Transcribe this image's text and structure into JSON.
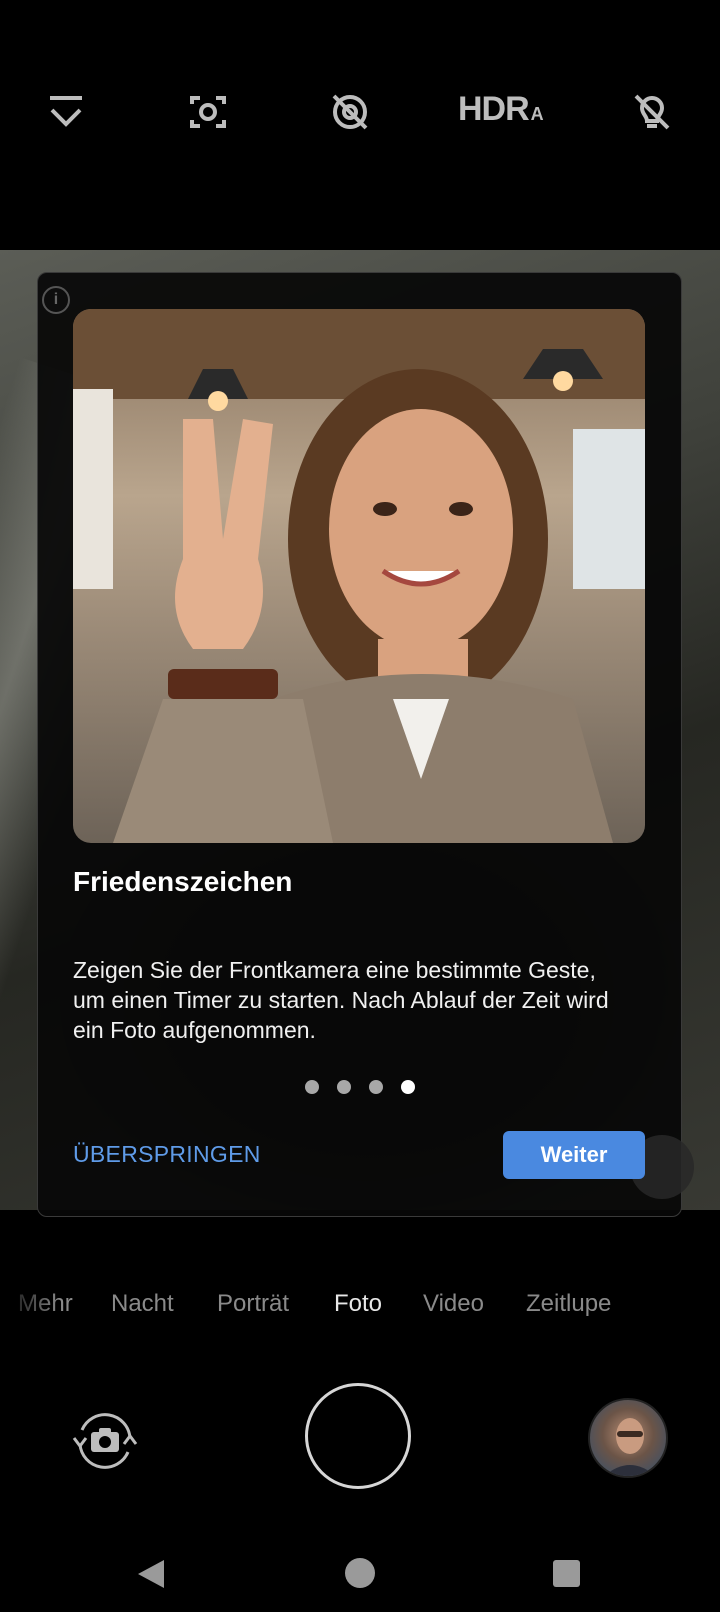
{
  "top_bar": {
    "icons": [
      "chevron-down-icon",
      "lens-icon",
      "motion-off-icon",
      "hdr-icon",
      "flash-off-icon"
    ],
    "hdr_label": "HDR",
    "hdr_sub": "A"
  },
  "dialog": {
    "image": "peace-sign-selfie-illustration",
    "title": "Friedenszeichen",
    "description": "Zeigen Sie der Frontkamera eine bestimmte Geste, um einen Timer zu starten. Nach Ablauf der Zeit wird ein Foto aufgenommen.",
    "page_count": 4,
    "current_page": 4,
    "skip_label": "ÜBERSPRINGEN",
    "next_label": "Weiter"
  },
  "modes": {
    "items": [
      "Mehr",
      "Nacht",
      "Porträt",
      "Foto",
      "Video",
      "Zeitlupe"
    ],
    "active": "Foto"
  },
  "colors": {
    "accent": "#4a89e0",
    "skip_text": "#5f9be8",
    "background": "#000000"
  }
}
